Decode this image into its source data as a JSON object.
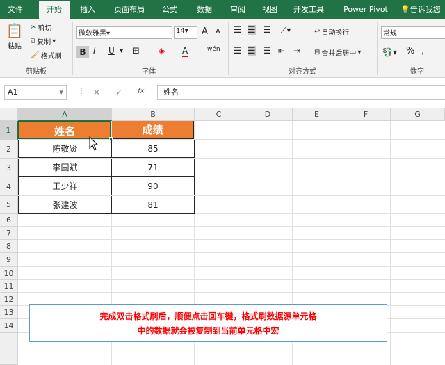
{
  "ribbon_tabs": [
    "文件",
    "开始",
    "插入",
    "页面布局",
    "公式",
    "数据",
    "审阅",
    "视图",
    "开发工具",
    "Power Pivot"
  ],
  "tell_me": "告诉我您",
  "clipboard": {
    "paste": "粘贴",
    "cut": "剪切",
    "copy": "复制",
    "format_painter": "格式刷",
    "label": "剪贴板"
  },
  "font": {
    "name": "微软雅黑",
    "size": "14",
    "bold": "B",
    "italic": "I",
    "underline": "U",
    "grow": "A",
    "shrink": "A",
    "label": "字体"
  },
  "alignment": {
    "wrap": "自动换行",
    "merge": "合并后居中",
    "label": "对齐方式"
  },
  "number": {
    "format": "常规",
    "percent": "%",
    "comma": ",",
    "label": "数字"
  },
  "formula_bar": {
    "name_box": "A1",
    "formula": "姓名",
    "fx": "fx",
    "cancel": "✕",
    "enter": "✓"
  },
  "columns": [
    "A",
    "B",
    "C",
    "D",
    "E",
    "F",
    "G"
  ],
  "rows": [
    "1",
    "2",
    "3",
    "4",
    "5",
    "6",
    "7",
    "8",
    "9",
    "10",
    "11",
    "12",
    "13",
    "14"
  ],
  "table": {
    "headers": [
      "姓名",
      "成绩"
    ],
    "rows": [
      [
        "陈敬贤",
        "85"
      ],
      [
        "李国斌",
        "71"
      ],
      [
        "王少祥",
        "90"
      ],
      [
        "张建波",
        "81"
      ]
    ]
  },
  "note": {
    "line1": "完成双击格式刷后，顺便点击回车键，格式刷数据源单元格",
    "line2": "中的数据就会被复制到当前单元格中宏"
  },
  "colors": {
    "accent": "#217346",
    "header_fill": "#ed7d31",
    "note_text": "#ff0000"
  }
}
